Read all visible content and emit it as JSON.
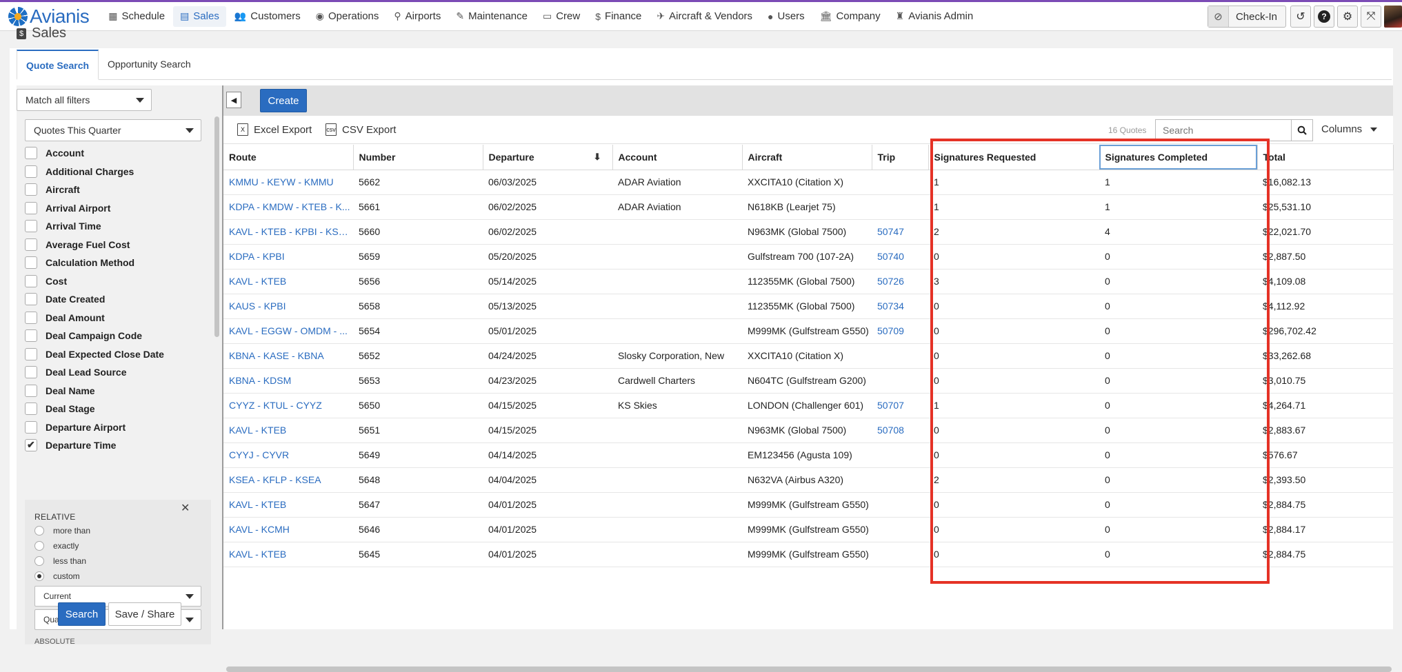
{
  "app": {
    "logo_text": "Avianis"
  },
  "nav": {
    "items": [
      {
        "label": "Schedule",
        "icon": "calendar-icon",
        "glyph": "▦"
      },
      {
        "label": "Sales",
        "icon": "document-dollar-icon",
        "glyph": "▤",
        "active": true
      },
      {
        "label": "Customers",
        "icon": "users-icon",
        "glyph": "👥"
      },
      {
        "label": "Operations",
        "icon": "globe-icon",
        "glyph": "◉"
      },
      {
        "label": "Airports",
        "icon": "map-pin-icon",
        "glyph": "⚲"
      },
      {
        "label": "Maintenance",
        "icon": "wrench-icon",
        "glyph": "✎"
      },
      {
        "label": "Crew",
        "icon": "id-card-icon",
        "glyph": "▭"
      },
      {
        "label": "Finance",
        "icon": "dollar-icon",
        "glyph": "$"
      },
      {
        "label": "Aircraft & Vendors",
        "icon": "plane-icon",
        "glyph": "✈"
      },
      {
        "label": "Users",
        "icon": "user-circle-icon",
        "glyph": "●"
      },
      {
        "label": "Company",
        "icon": "building-icon",
        "glyph": "🏛"
      },
      {
        "label": "Avianis Admin",
        "icon": "admin-icon",
        "glyph": "♜"
      }
    ],
    "checkin_label": "Check-In"
  },
  "page": {
    "title": "Sales",
    "tabs": [
      "Quote Search",
      "Opportunity Search"
    ]
  },
  "filters": {
    "match_mode": "Match all filters",
    "saved_search": "Quotes This Quarter",
    "items": [
      {
        "label": "Account",
        "checked": false
      },
      {
        "label": "Additional Charges",
        "checked": false
      },
      {
        "label": "Aircraft",
        "checked": false
      },
      {
        "label": "Arrival Airport",
        "checked": false
      },
      {
        "label": "Arrival Time",
        "checked": false
      },
      {
        "label": "Average Fuel Cost",
        "checked": false
      },
      {
        "label": "Calculation Method",
        "checked": false
      },
      {
        "label": "Cost",
        "checked": false
      },
      {
        "label": "Date Created",
        "checked": false
      },
      {
        "label": "Deal Amount",
        "checked": false
      },
      {
        "label": "Deal Campaign Code",
        "checked": false
      },
      {
        "label": "Deal Expected Close Date",
        "checked": false
      },
      {
        "label": "Deal Lead Source",
        "checked": false
      },
      {
        "label": "Deal Name",
        "checked": false
      },
      {
        "label": "Deal Stage",
        "checked": false
      },
      {
        "label": "Departure Airport",
        "checked": false
      },
      {
        "label": "Departure Time",
        "checked": true
      }
    ],
    "time_panel": {
      "heading": "RELATIVE",
      "options": [
        "more than",
        "exactly",
        "less than",
        "custom"
      ],
      "selected": "custom",
      "period_select": "Current",
      "unit_select": "Quarter",
      "next_heading": "ABSOLUTE"
    },
    "search_label": "Search",
    "save_label": "Save / Share"
  },
  "results": {
    "create_label": "Create",
    "excel_label": "Excel Export",
    "csv_label": "CSV Export",
    "count_label": "16 Quotes",
    "search_placeholder": "Search",
    "columns_label": "Columns",
    "columns": [
      "Route",
      "Number",
      "Departure",
      "Account",
      "Aircraft",
      "Trip",
      "Signatures Requested",
      "Signatures Completed",
      "Total"
    ],
    "rows": [
      [
        "KMMU - KEYW - KMMU",
        "5662",
        "06/03/2025",
        "ADAR Aviation",
        "XXCITA10 (Citation X)",
        "",
        "1",
        "1",
        "$16,082.13"
      ],
      [
        "KDPA - KMDW - KTEB - K...",
        "5661",
        "06/02/2025",
        "ADAR Aviation",
        "N618KB (Learjet 75)",
        "",
        "1",
        "1",
        "$25,531.10"
      ],
      [
        "KAVL - KTEB - KPBI - KSM...",
        "5660",
        "06/02/2025",
        "",
        "N963MK (Global 7500)",
        "50747",
        "2",
        "4",
        "$22,021.70"
      ],
      [
        "KDPA - KPBI",
        "5659",
        "05/20/2025",
        "",
        "Gulfstream 700 (107-2A)",
        "50740",
        "0",
        "0",
        "$2,887.50"
      ],
      [
        "KAVL - KTEB",
        "5656",
        "05/14/2025",
        "",
        "112355MK (Global 7500)",
        "50726",
        "3",
        "0",
        "$4,109.08"
      ],
      [
        "KAUS - KPBI",
        "5658",
        "05/13/2025",
        "",
        "112355MK (Global 7500)",
        "50734",
        "0",
        "0",
        "$4,112.92"
      ],
      [
        "KAVL - EGGW - OMDM - ...",
        "5654",
        "05/01/2025",
        "",
        "M999MK (Gulfstream G550)",
        "50709",
        "0",
        "0",
        "$296,702.42"
      ],
      [
        "KBNA - KASE - KBNA",
        "5652",
        "04/24/2025",
        "Slosky Corporation, New",
        "XXCITA10 (Citation X)",
        "",
        "0",
        "0",
        "$33,262.68"
      ],
      [
        "KBNA - KDSM",
        "5653",
        "04/23/2025",
        "Cardwell Charters",
        "N604TC (Gulfstream G200)",
        "",
        "0",
        "0",
        "$3,010.75"
      ],
      [
        "CYYZ - KTUL - CYYZ",
        "5650",
        "04/15/2025",
        "KS Skies",
        "LONDON (Challenger 601)",
        "50707",
        "1",
        "0",
        "$4,264.71"
      ],
      [
        "KAVL - KTEB",
        "5651",
        "04/15/2025",
        "",
        "N963MK (Global 7500)",
        "50708",
        "0",
        "0",
        "$2,883.67"
      ],
      [
        "CYYJ - CYVR",
        "5649",
        "04/14/2025",
        "",
        "EM123456 (Agusta 109)",
        "",
        "0",
        "0",
        "$576.67"
      ],
      [
        "KSEA - KFLP - KSEA",
        "5648",
        "04/04/2025",
        "",
        "N632VA (Airbus A320)",
        "",
        "2",
        "0",
        "$2,393.50"
      ],
      [
        "KAVL - KTEB",
        "5647",
        "04/01/2025",
        "",
        "M999MK (Gulfstream G550)",
        "",
        "0",
        "0",
        "$2,884.75"
      ],
      [
        "KAVL - KCMH",
        "5646",
        "04/01/2025",
        "",
        "M999MK (Gulfstream G550)",
        "",
        "0",
        "0",
        "$2,884.17"
      ],
      [
        "KAVL - KTEB",
        "5645",
        "04/01/2025",
        "",
        "M999MK (Gulfstream G550)",
        "",
        "0",
        "0",
        "$2,884.75"
      ]
    ]
  },
  "colors": {
    "brand_blue": "#2a6cc0",
    "highlight_red": "#e53226"
  }
}
